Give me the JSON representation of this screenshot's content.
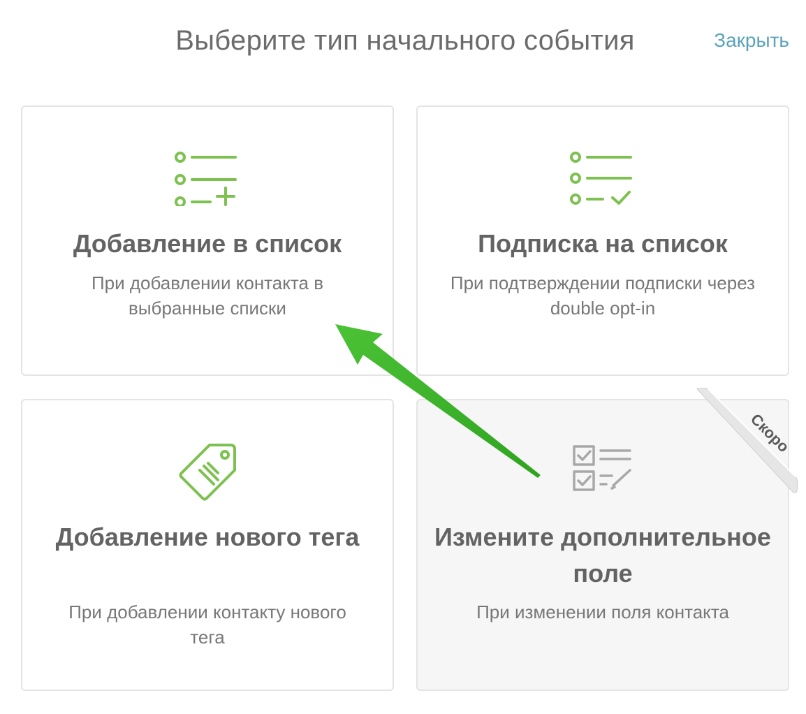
{
  "header": {
    "title": "Выберите тип начального события",
    "close_label": "Закрыть"
  },
  "cards": [
    {
      "title": "Добавление в список",
      "description": "При добавлении контакта в выбранные списки",
      "icon": "list-add-icon"
    },
    {
      "title": "Подписка на список",
      "description": "При подтверждении подписки через double opt-in",
      "icon": "list-check-icon"
    },
    {
      "title": "Добавление нового тега",
      "description": "При добавлении контакту нового тега",
      "icon": "tag-icon"
    },
    {
      "title": "Измените дополнительное поле",
      "description": "При изменении поля контакта",
      "icon": "checklist-edit-icon",
      "badge": "Скоро",
      "disabled": true
    }
  ],
  "colors": {
    "accent_green": "#7dc150",
    "link_blue": "#5aa3b8",
    "arrow_green": "#3fb52a",
    "disabled_icon": "#a8a8a8"
  }
}
